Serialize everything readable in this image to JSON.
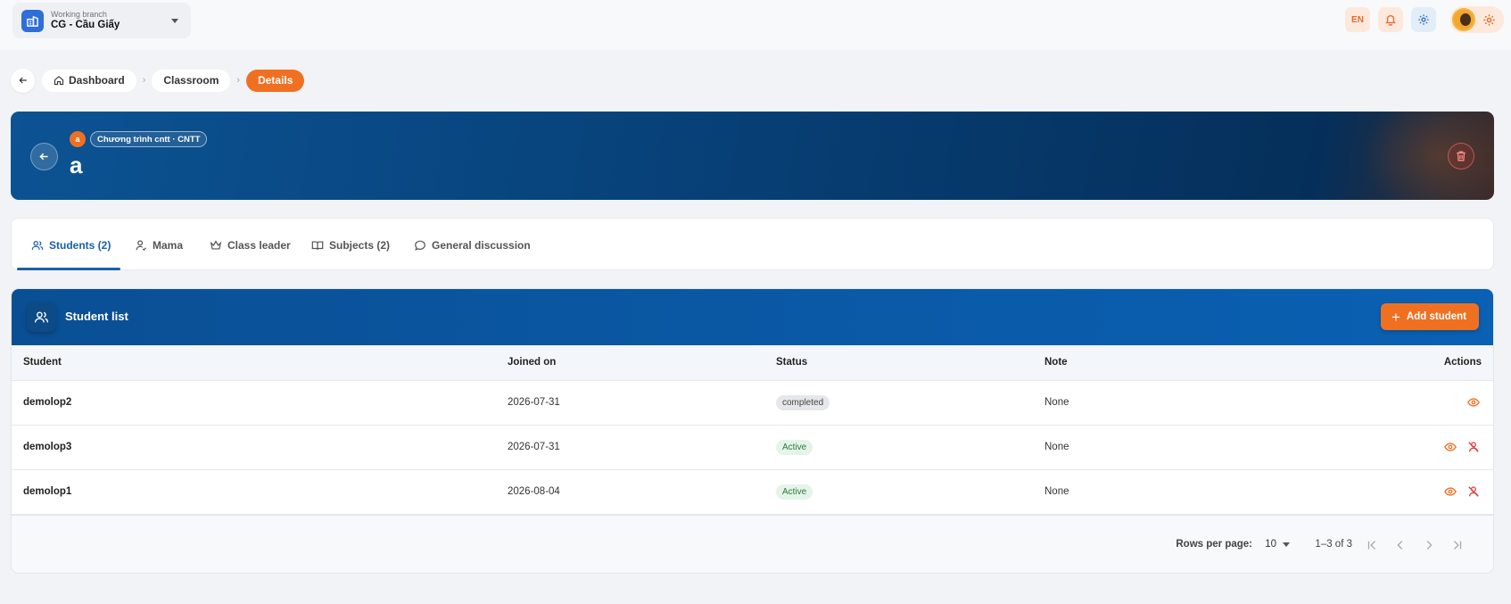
{
  "branch": {
    "label": "Working branch",
    "name": "CG - Cầu Giấy"
  },
  "top_actions": {
    "lang": "EN"
  },
  "breadcrumb": {
    "items": [
      "Dashboard",
      "Classroom",
      "Details"
    ]
  },
  "hero": {
    "badge_letter": "a",
    "tag": "Chương trình cntt · CNTT",
    "title": "a"
  },
  "tabs": [
    {
      "label": "Students (2)",
      "icon": "users-icon"
    },
    {
      "label": "Mama",
      "icon": "user-icon"
    },
    {
      "label": "Class leader",
      "icon": "crown-icon"
    },
    {
      "label": "Subjects (2)",
      "icon": "book-icon"
    },
    {
      "label": "General discussion",
      "icon": "chat-icon"
    }
  ],
  "student_list": {
    "title": "Student list",
    "add_label": "Add student",
    "columns": [
      "Student",
      "Joined on",
      "Status",
      "Note",
      "Actions"
    ],
    "rows": [
      {
        "student": "demolop2",
        "joined": "2026-07-31",
        "status": "completed",
        "note": "None"
      },
      {
        "student": "demolop3",
        "joined": "2026-07-31",
        "status": "Active",
        "note": "None"
      },
      {
        "student": "demolop1",
        "joined": "2026-08-04",
        "status": "Active",
        "note": "None"
      }
    ]
  },
  "pagination": {
    "rows_label": "Rows per page:",
    "rows_value": "10",
    "range": "1–3 of 3"
  },
  "colors": {
    "accent": "#f07022",
    "primary": "#0a5aa8",
    "hero_dark": "#052f5a"
  }
}
